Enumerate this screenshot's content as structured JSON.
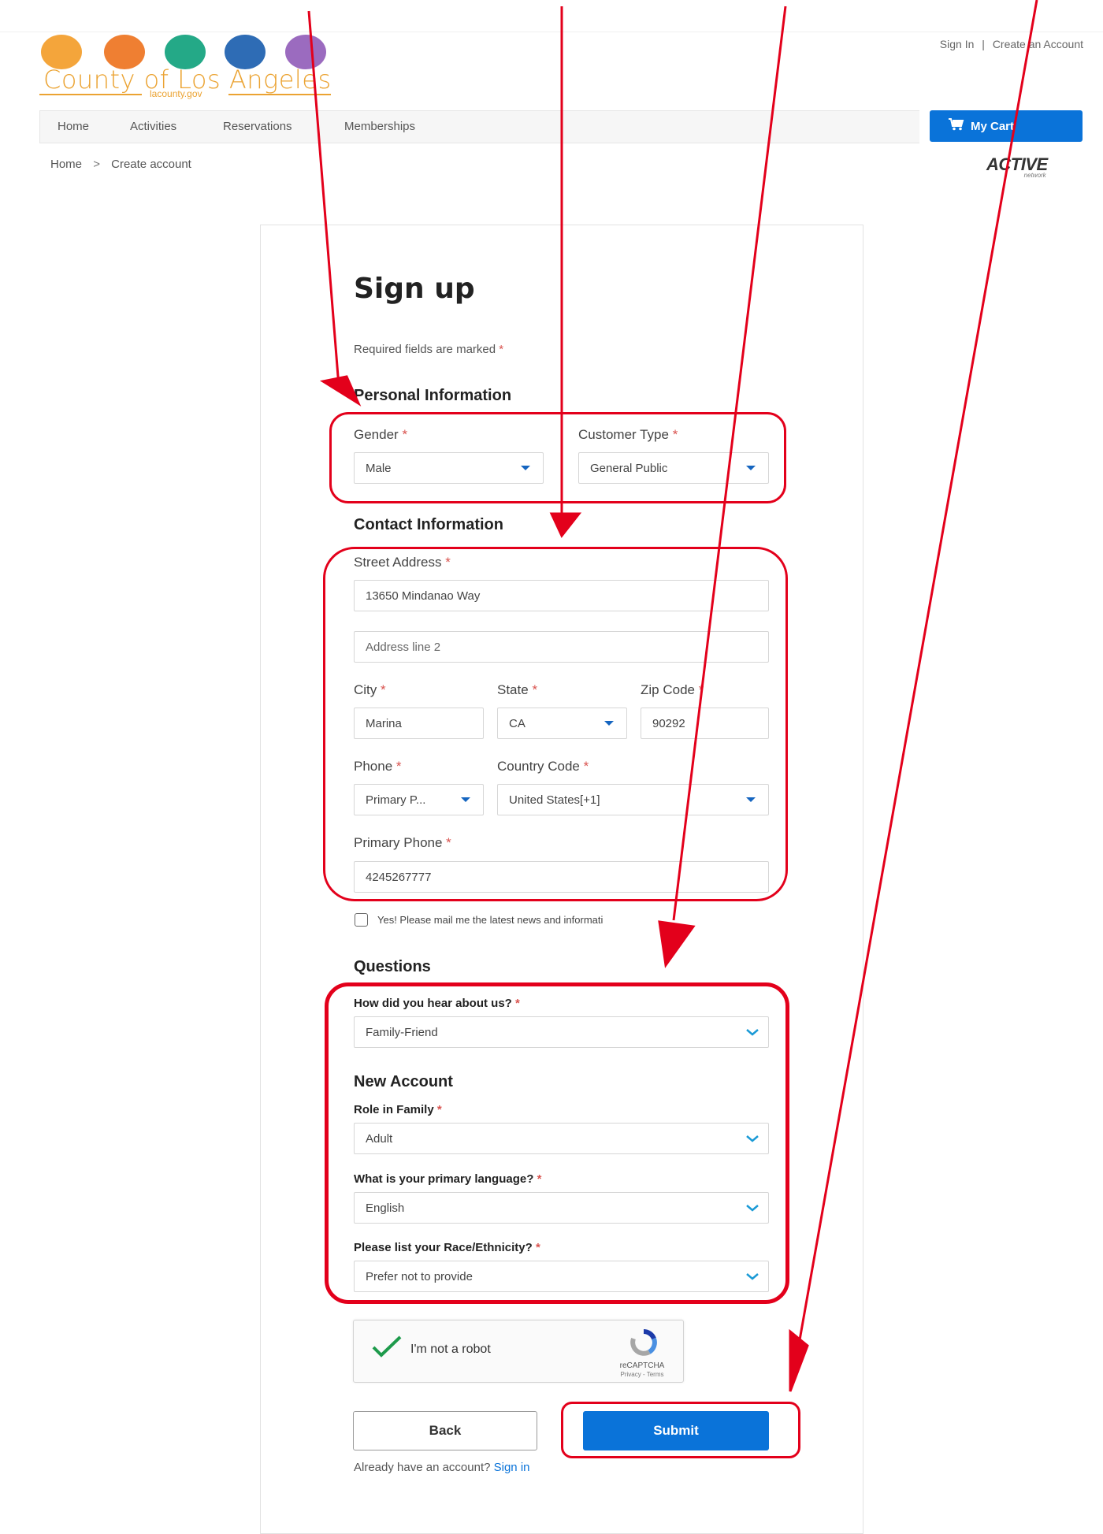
{
  "header": {
    "logo_text": "County of Los Angeles",
    "logo_sub": "lacounty.gov",
    "sign_in": "Sign In",
    "separator": "|",
    "create_account": "Create an Account",
    "brand_colors": [
      "#f4a53b",
      "#ef7f32",
      "#24a987",
      "#2e6cb5",
      "#9b6bbf"
    ]
  },
  "nav": {
    "items": [
      "Home",
      "Activities",
      "Reservations",
      "Memberships"
    ],
    "cart_label": "My Cart",
    "cart_icon": "cart-icon"
  },
  "breadcrumb": {
    "home": "Home",
    "separator": ">",
    "current": "Create account"
  },
  "partner_logo": {
    "main": "ACTIVE",
    "sub": "network"
  },
  "form": {
    "title": "Sign up",
    "required_note": "Required fields are marked",
    "required_star": "*",
    "personal": {
      "title": "Personal Information",
      "gender_label": "Gender",
      "gender_value": "Male",
      "customer_type_label": "Customer Type",
      "customer_type_value": "General Public"
    },
    "contact": {
      "title": "Contact Information",
      "street_label": "Street Address",
      "street_value": "13650 Mindanao Way",
      "address2_placeholder": "Address line 2",
      "city_label": "City",
      "city_value": "Marina",
      "state_label": "State",
      "state_value": "CA",
      "zip_label": "Zip Code",
      "zip_value": "90292",
      "phone_label": "Phone",
      "phone_value": "Primary P...",
      "country_code_label": "Country Code",
      "country_code_value": "United States[+1]",
      "primary_phone_label": "Primary Phone",
      "primary_phone_value": "4245267777"
    },
    "newsletter_label": "Yes! Please mail me the latest news and informati",
    "questions": {
      "title": "Questions",
      "hear_label": "How did you hear about us?",
      "hear_value": "Family-Friend"
    },
    "new_account": {
      "title": "New Account",
      "role_label": "Role in Family",
      "role_value": "Adult",
      "language_label": "What is your primary language?",
      "language_value": "English",
      "race_label": "Please list your Race/Ethnicity?",
      "race_value": "Prefer not to provide"
    },
    "captcha": {
      "label": "I'm not a robot",
      "brand": "reCAPTCHA",
      "terms": "Privacy - Terms"
    },
    "back_label": "Back",
    "submit_label": "Submit",
    "already_text": "Already have an account?",
    "sign_in_link": "Sign in"
  },
  "annotation_color": "#e3001b"
}
